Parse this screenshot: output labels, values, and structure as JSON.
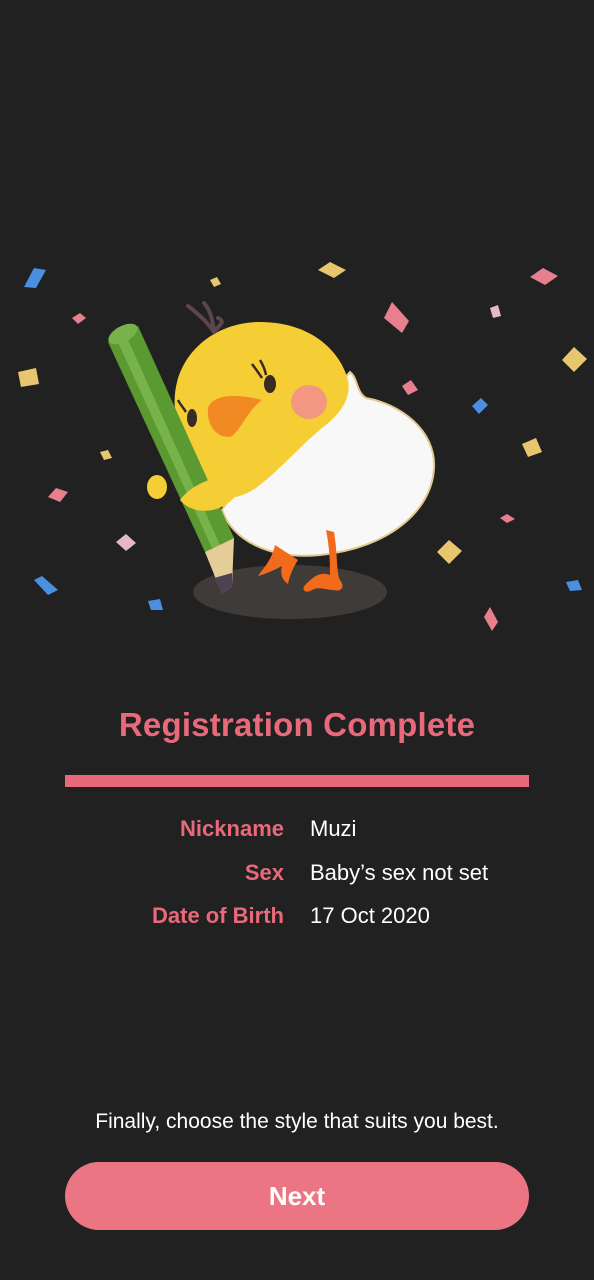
{
  "title": "Registration Complete",
  "profile": {
    "rows": [
      {
        "label": "Nickname",
        "value": "Muzi"
      },
      {
        "label": "Sex",
        "value": "Baby’s sex not set"
      },
      {
        "label": "Date of Birth",
        "value": "17 Oct 2020"
      }
    ]
  },
  "footer_text": "Finally, choose the style that suits you best.",
  "next_button": {
    "label": "Next"
  },
  "colors": {
    "background": "#212121",
    "accent": "#e86a7a",
    "button": "#ec7584",
    "chick": "#f5cd34",
    "pencil": "#5a9a30"
  },
  "illustration": {
    "icon": "chick-with-pencil-celebration-icon"
  }
}
